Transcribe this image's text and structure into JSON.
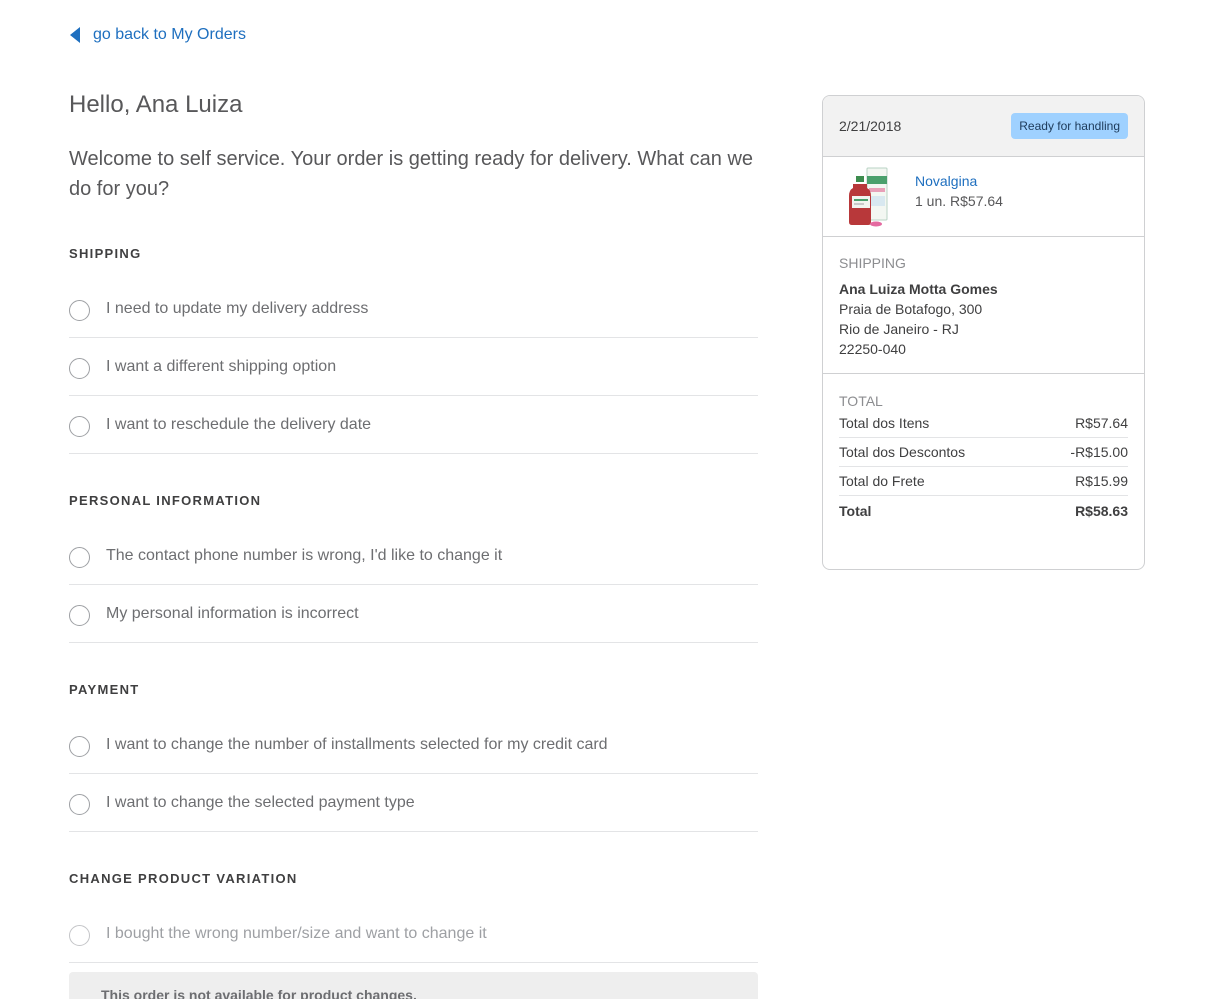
{
  "back_link": "go back to My Orders",
  "greeting": "Hello, Ana Luiza",
  "welcome": "Welcome to self service. Your order is getting ready for delivery. What can we do for you?",
  "sections": [
    {
      "title": "SHIPPING",
      "options": [
        "I need to update my delivery address",
        "I want a different shipping option",
        "I want to reschedule the delivery date"
      ]
    },
    {
      "title": "PERSONAL INFORMATION",
      "options": [
        "The contact phone number is wrong, I'd like to change it",
        "My personal information is incorrect"
      ]
    },
    {
      "title": "PAYMENT",
      "options": [
        "I want to change the number of installments selected for my credit card",
        "I want to change the selected payment type"
      ]
    },
    {
      "title": "CHANGE PRODUCT VARIATION",
      "options": [
        "I bought the wrong number/size and want to change it"
      ]
    }
  ],
  "product_change_notice": "This order is not available for product changes.",
  "order": {
    "date": "2/21/2018",
    "status": "Ready for handling",
    "status_color": "#9fd1ff",
    "product": {
      "name": "Novalgina",
      "quantity_price": "1 un.  R$57.64"
    },
    "shipping": {
      "label": "SHIPPING",
      "name": "Ana Luiza Motta Gomes",
      "address": "Praia de Botafogo, 300",
      "city": "Rio de Janeiro - RJ",
      "zip": "22250-040"
    },
    "totals": {
      "label": "TOTAL",
      "rows": [
        {
          "label": "Total dos Itens",
          "value": "R$57.64"
        },
        {
          "label": "Total dos Descontos",
          "value": "-R$15.00"
        },
        {
          "label": "Total do Frete",
          "value": "R$15.99"
        },
        {
          "label": "Total",
          "value": "R$58.63"
        }
      ]
    }
  },
  "accent_color": "#1e6fbf"
}
